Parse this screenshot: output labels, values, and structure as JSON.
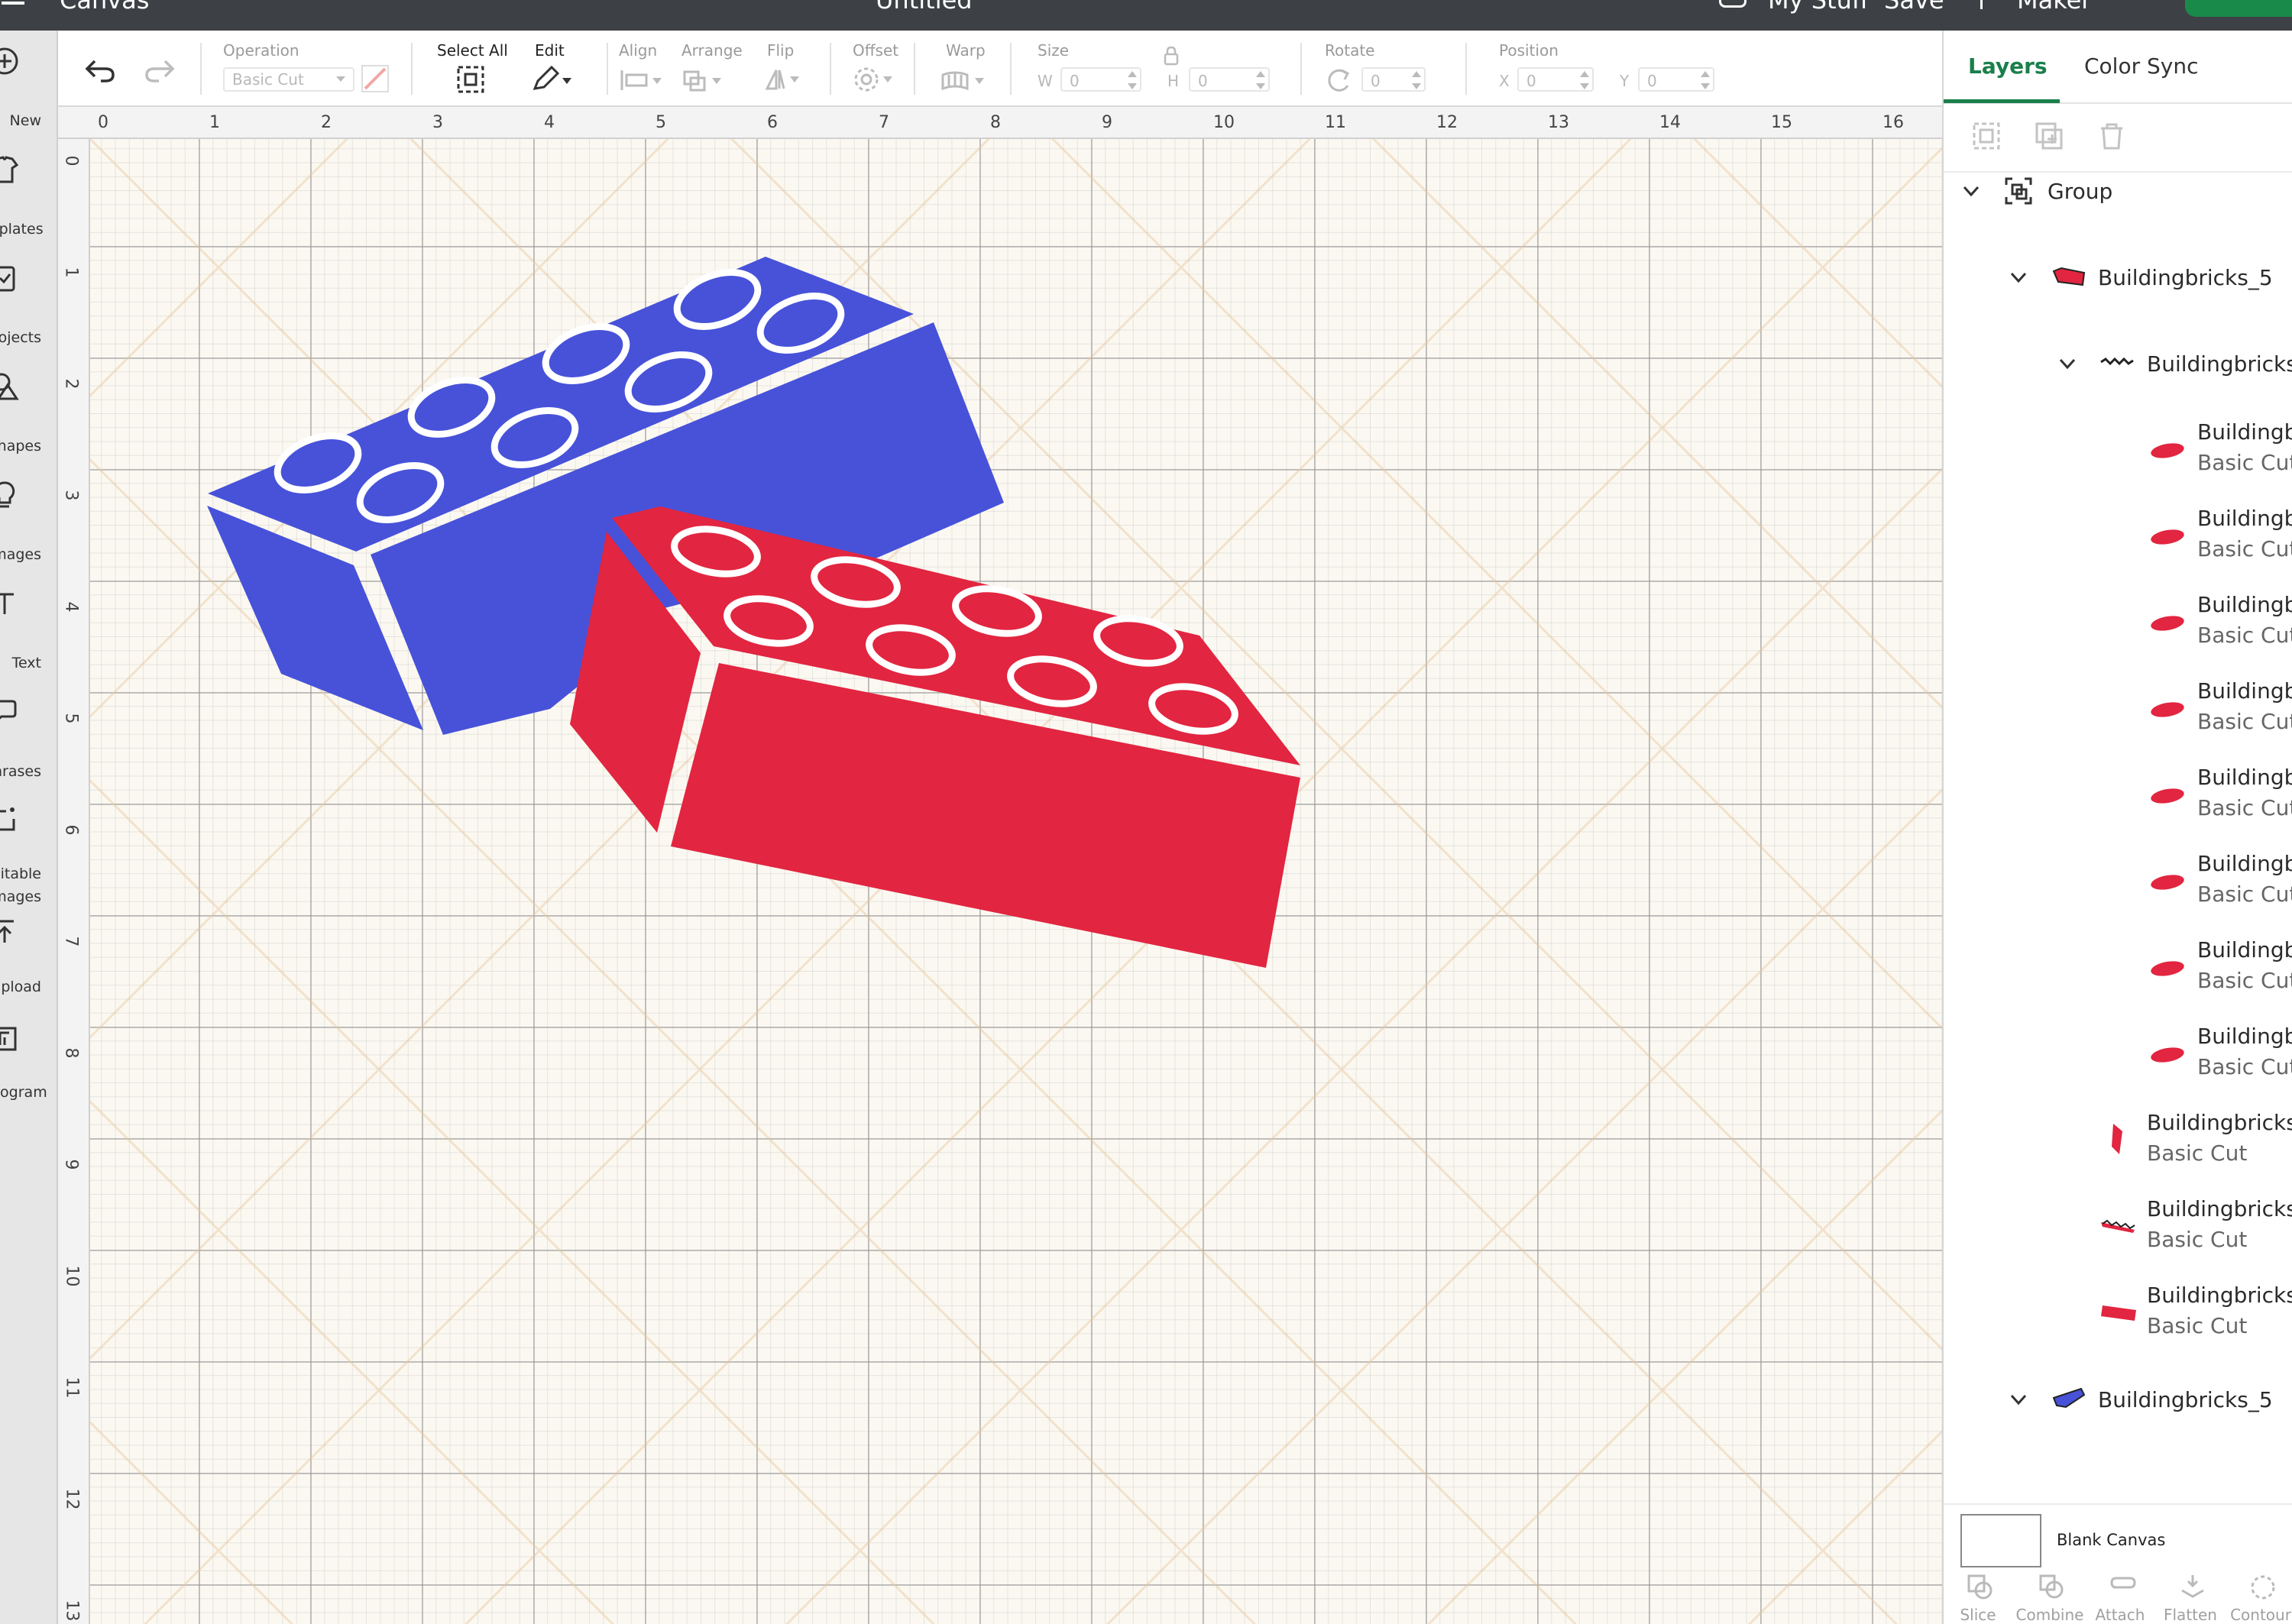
{
  "topbar": {
    "left_title": "Canvas",
    "doc_title": "Untitled",
    "my_stuff": "My Stuff",
    "save": "Save",
    "machine": "Maker"
  },
  "leftnav": {
    "items": [
      {
        "label": "New",
        "icon": "plus-circle-icon"
      },
      {
        "label": "Templates",
        "icon": "shirt-icon"
      },
      {
        "label": "Projects",
        "icon": "clipboard-icon"
      },
      {
        "label": "Shapes",
        "icon": "shapes-icon"
      },
      {
        "label": "Images",
        "icon": "bulb-icon"
      },
      {
        "label": "Text",
        "icon": "text-icon"
      },
      {
        "label": "Phrases",
        "icon": "speech-bubbles-icon"
      },
      {
        "label": "Editable",
        "label2": "Images",
        "icon": "editable-image-icon"
      },
      {
        "label": "Upload",
        "icon": "upload-icon"
      },
      {
        "label": "Monogram",
        "icon": "monogram-icon"
      }
    ]
  },
  "toolbar": {
    "operation_label": "Operation",
    "operation_value": "Basic Cut",
    "select_all": "Select All",
    "edit": "Edit",
    "align": "Align",
    "arrange": "Arrange",
    "flip": "Flip",
    "offset": "Offset",
    "warp": "Warp",
    "size": "Size",
    "w_label": "W",
    "h_label": "H",
    "w_value": "0",
    "h_value": "0",
    "rotate": "Rotate",
    "rotate_value": "0",
    "position": "Position",
    "x_label": "X",
    "y_label": "Y",
    "x_value": "0",
    "y_value": "0"
  },
  "ruler": {
    "h": [
      "0",
      "1",
      "2",
      "3",
      "4",
      "5",
      "6",
      "7",
      "8",
      "9",
      "10",
      "11",
      "12",
      "13",
      "14",
      "15",
      "16"
    ],
    "v": [
      "0",
      "1",
      "2",
      "3",
      "4",
      "5",
      "6",
      "7",
      "8",
      "9",
      "10",
      "11",
      "12",
      "13"
    ]
  },
  "colors": {
    "blue_brick": "#4752d9",
    "red_brick": "#e22540",
    "accent_green": "#1a7f4b",
    "toolbar_bg": "#3d4145"
  },
  "panel": {
    "tabs": [
      "Layers",
      "Color Sync"
    ],
    "active_tab": "Layers",
    "layers": [
      {
        "name": "Group",
        "sub": ""
      },
      {
        "name": "Buildingbricks_5",
        "sub": ""
      },
      {
        "name": "Buildingbricks",
        "sub": ""
      },
      {
        "name": "Buildingb",
        "sub": "Basic Cut"
      },
      {
        "name": "Buildingb",
        "sub": "Basic Cut"
      },
      {
        "name": "Buildingb",
        "sub": "Basic Cut"
      },
      {
        "name": "Buildingb",
        "sub": "Basic Cut"
      },
      {
        "name": "Buildingb",
        "sub": "Basic Cut"
      },
      {
        "name": "Buildingb",
        "sub": "Basic Cut"
      },
      {
        "name": "Buildingb",
        "sub": "Basic Cut"
      },
      {
        "name": "Buildingb",
        "sub": "Basic Cut"
      },
      {
        "name": "Buildingbricks",
        "sub": "Basic Cut"
      },
      {
        "name": "Buildingbricks",
        "sub": "Basic Cut"
      },
      {
        "name": "Buildingbricks",
        "sub": "Basic Cut"
      },
      {
        "name": "Buildingbricks_5",
        "sub": ""
      }
    ],
    "blank_canvas": "Blank Canvas",
    "actions": [
      "Slice",
      "Combine",
      "Attach",
      "Flatten",
      "Contour"
    ]
  }
}
